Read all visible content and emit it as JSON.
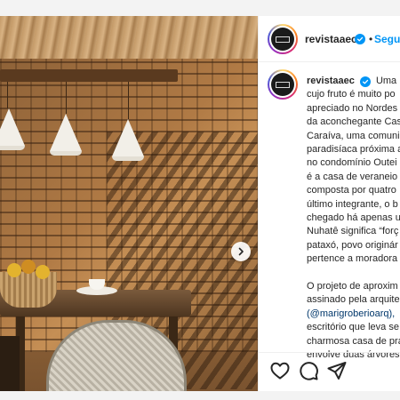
{
  "post": {
    "username": "revistaaec",
    "follow_label": "Seguir",
    "separator": "•",
    "caption_lines": [
      "Uma ma",
      "cujo fruto é muito po",
      "apreciado no Nordes",
      "da aconchegante Cas",
      "Caraíva, uma comuni",
      "paradisíaca próxima a",
      "no condomínio Outei",
      "é a casa de veraneio c",
      "composta por quatro",
      "último integrante, o b",
      "chegado há apenas u",
      "Nuhatê significa “forç",
      "pataxó, povo originár",
      "pertence a moradora",
      "",
      "O projeto de aproxim",
      "assinado pela arquite",
      "(@marigroberioarq),",
      "escritório que leva se",
      "charmosa casa de pra",
      "envolve duas árvores"
    ]
  },
  "icons": {
    "verified": "verified-badge-icon",
    "next": "chevron-right-icon",
    "like": "heart-icon",
    "comment": "comment-bubble-icon",
    "share": "paper-plane-icon"
  },
  "colors": {
    "accent": "#0095f6",
    "text": "#262626",
    "border": "#efefef"
  }
}
